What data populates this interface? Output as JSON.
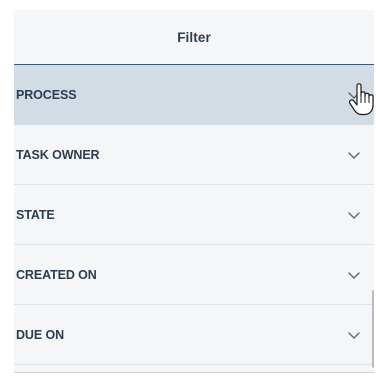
{
  "header": {
    "title": "Filter"
  },
  "filters": [
    {
      "label": "PROCESS",
      "active": true,
      "icon": "chevron-down-icon"
    },
    {
      "label": "TASK OWNER",
      "active": false,
      "icon": "chevron-down-icon"
    },
    {
      "label": "STATE",
      "active": false,
      "icon": "chevron-down-icon"
    },
    {
      "label": "CREATED ON",
      "active": false,
      "icon": "chevron-down-icon"
    },
    {
      "label": "DUE ON",
      "active": false,
      "icon": "chevron-down-icon"
    }
  ],
  "colors": {
    "panel_bg": "#f5f6f7",
    "active_bg": "#d1dce4",
    "header_border": "#3d5873",
    "text": "#2b3d4f",
    "chevron": "#5a6f84"
  },
  "cursor": "hand-pointer-icon"
}
